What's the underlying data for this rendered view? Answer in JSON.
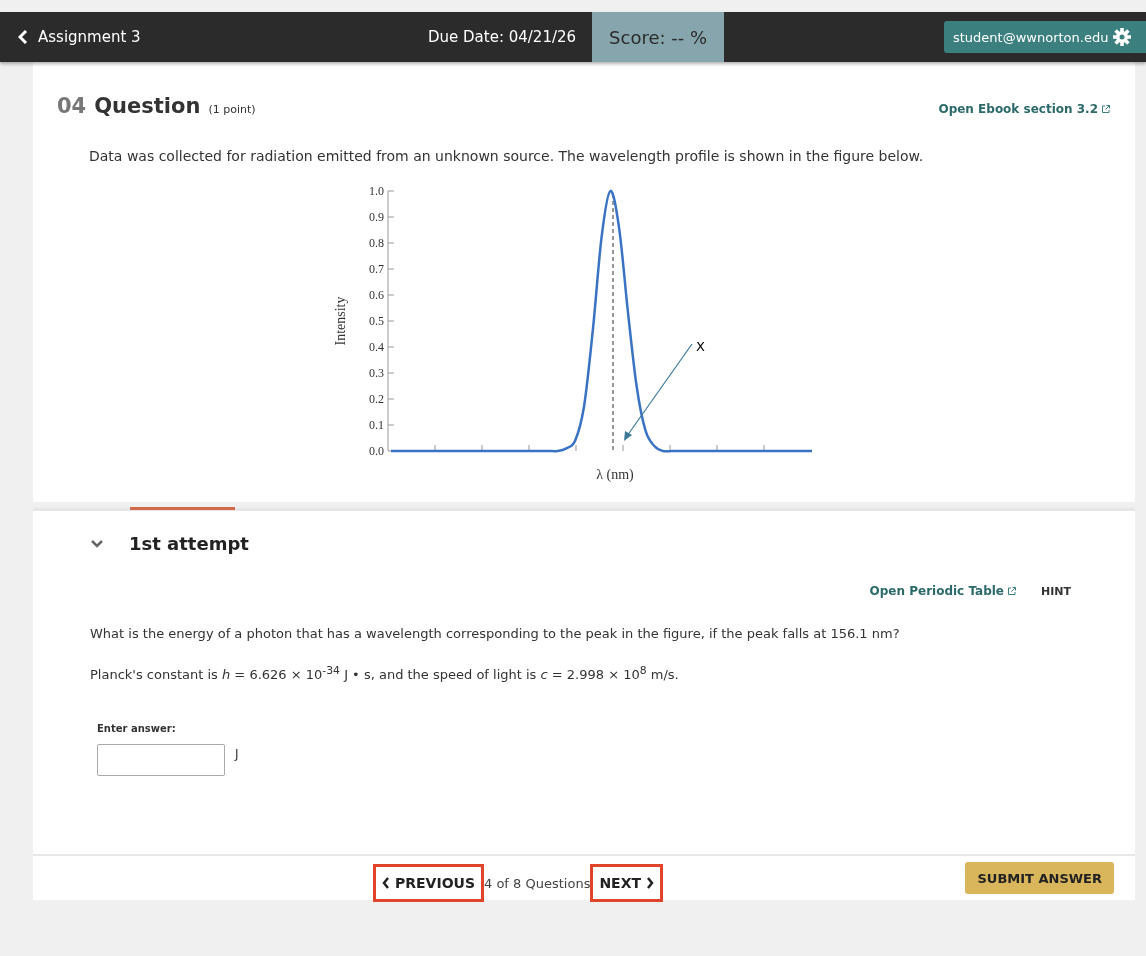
{
  "header": {
    "back_label": "Assignment 3",
    "due_date": "Due Date: 04/21/26",
    "score": "Score: -- %",
    "user": "student@wwnorton.edu"
  },
  "question": {
    "number": "04",
    "title": "Question",
    "points": "(1 point)",
    "ebook_link": "Open Ebook section 3.2",
    "prompt": "Data was collected for radiation emitted from an unknown source. The wavelength profile is shown in the figure below.",
    "figure": {
      "annotation": "X",
      "chart_data": {
        "type": "line",
        "xlabel": "λ (nm)",
        "ylabel": "Intensity",
        "ylim": [
          0,
          1
        ],
        "yticks": [
          {
            "value": 1,
            "label": "1.0"
          },
          {
            "value": 0.9,
            "label": "0.9"
          },
          {
            "value": 0.8,
            "label": "0.8"
          },
          {
            "value": 0.7,
            "label": "0.7"
          },
          {
            "value": 0.6,
            "label": "0.6"
          },
          {
            "value": 0.5,
            "label": "0.5"
          },
          {
            "value": 0.4,
            "label": "0.4"
          },
          {
            "value": 0.3,
            "label": "0.3"
          },
          {
            "value": 0.2,
            "label": "0.2"
          },
          {
            "value": 0.1,
            "label": "0.1"
          },
          {
            "value": 0,
            "label": "0.0"
          }
        ],
        "series": [
          {
            "color": "#3a73c4",
            "values": [
              0,
              0,
              0,
              0,
              0,
              0,
              0,
              0,
              0,
              0,
              0,
              0,
              0,
              0,
              0,
              0,
              0,
              0,
              0,
              0,
              0.01,
              0.04,
              0.17,
              0.46,
              0.82,
              1,
              0.86,
              0.54,
              0.25,
              0.08,
              0.02,
              0,
              0,
              0,
              0,
              0,
              0,
              0,
              0,
              0,
              0,
              0,
              0,
              0,
              0,
              0,
              0,
              0,
              0
            ]
          }
        ]
      }
    }
  },
  "attempt": {
    "label": "1st attempt",
    "expanded": true,
    "selected": true
  },
  "tools": {
    "periodic_link": "Open Periodic Table",
    "hint": "HINT"
  },
  "body": [
    "What is the energy of a photon that has a wavelength corresponding to the peak in the figure, if the peak falls at 156.1 nm?",
    "Planck's constant is *h* = 6.626 × 10$^{-34}$ J • s, and the speed of light is *c* = 2.998 × 10$^{8}$ m/s."
  ],
  "answer": {
    "label": "Enter answer:",
    "unit": "J"
  },
  "footer": {
    "previous": {
      "label": "PREVIOUS",
      "highlighted": true
    },
    "progress": "4 of 8 Questions",
    "next": {
      "label": "NEXT",
      "highlighted": true
    },
    "submit": "SUBMIT ANSWER"
  }
}
